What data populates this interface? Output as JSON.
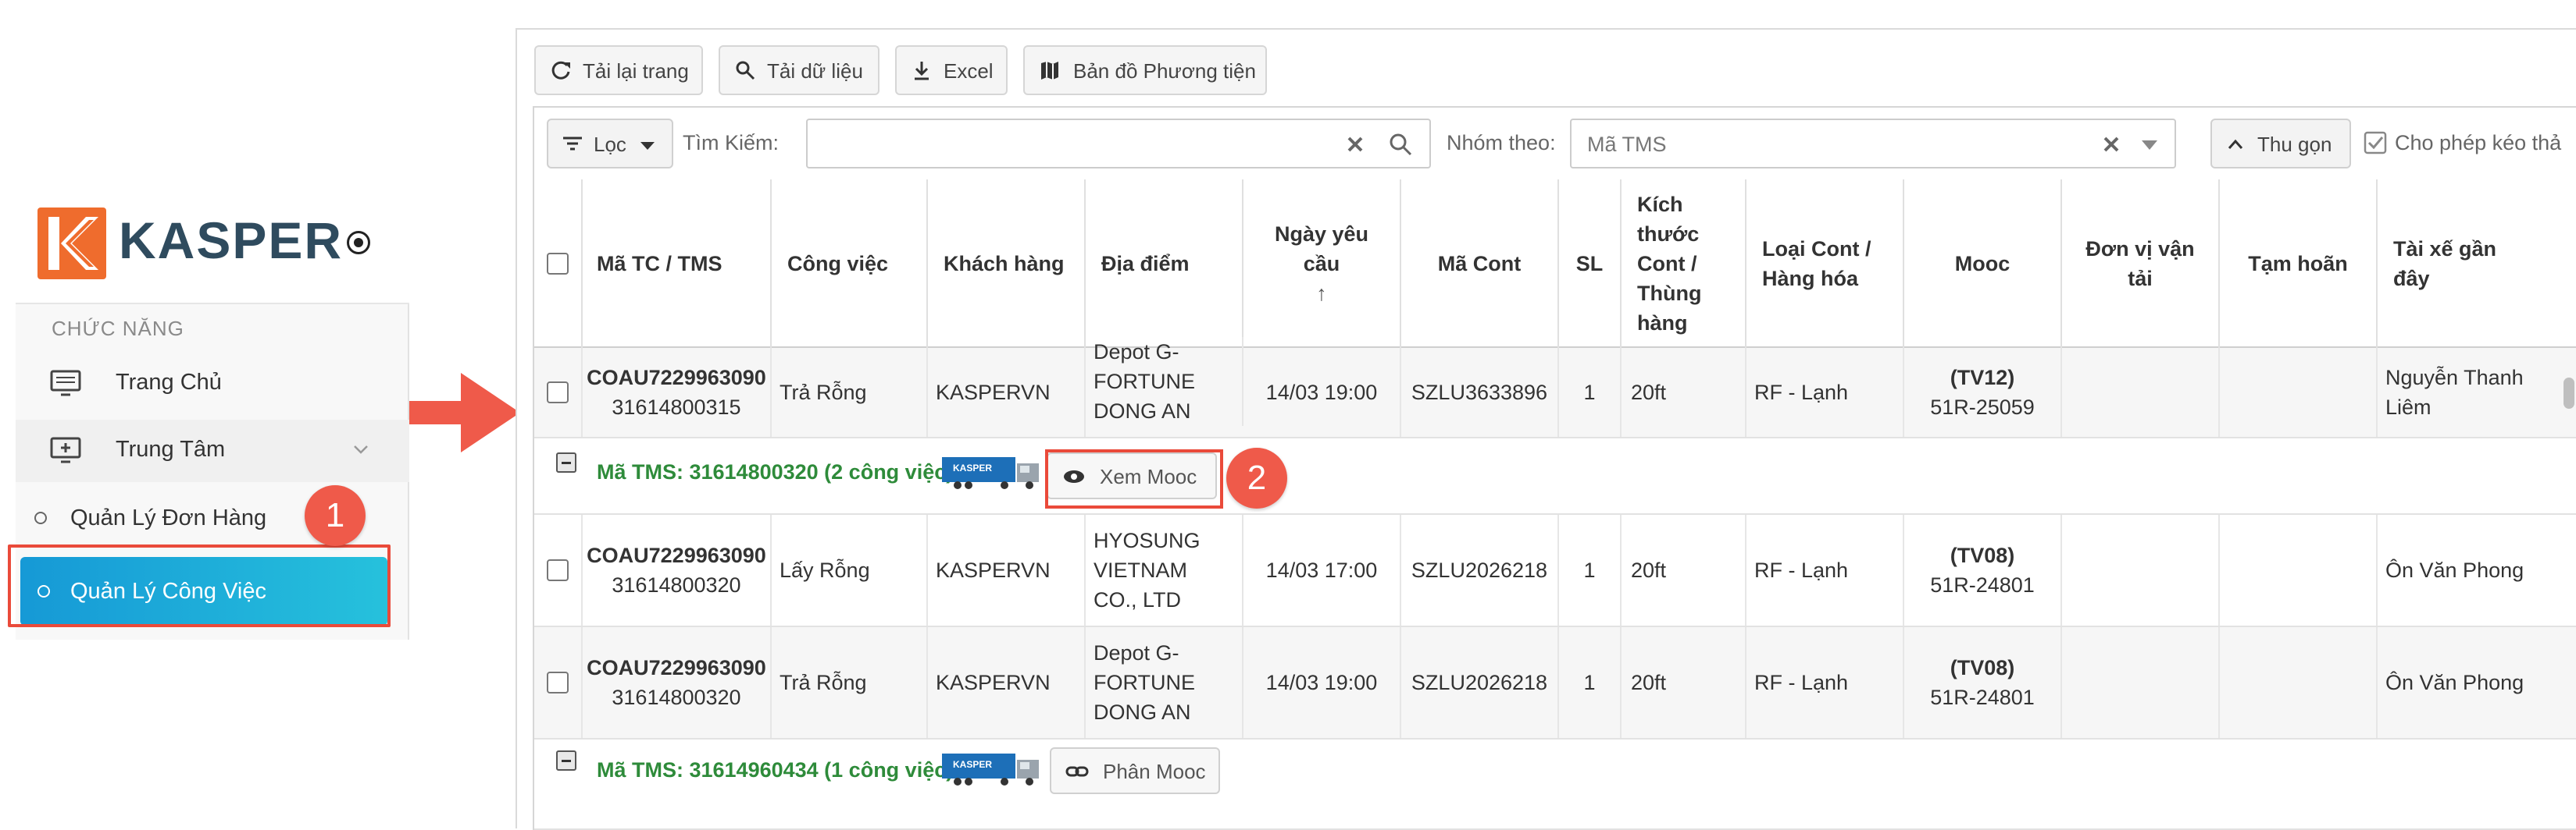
{
  "sidebar": {
    "brand": "KASPER",
    "section_label": "CHỨC NĂNG",
    "items": [
      {
        "label": "Trang Chủ"
      },
      {
        "label": "Trung Tâm"
      }
    ],
    "sub_items": [
      {
        "label": "Quản Lý Đơn Hàng"
      },
      {
        "label": "Quản Lý Công Việc"
      }
    ]
  },
  "markers": [
    "1",
    "2"
  ],
  "toolbar": {
    "reload": "Tải lại trang",
    "load_data": "Tải dữ liệu",
    "excel": "Excel",
    "vehicle_map": "Bản đồ Phương tiện"
  },
  "filter": {
    "filter_button": "Lọc",
    "search_label": "Tìm Kiếm:",
    "search_value": "",
    "group_label": "Nhóm theo:",
    "group_value": "Mã TMS",
    "collapse_button": "Thu gọn",
    "allow_drag_label": "Cho phép kéo thả"
  },
  "table": {
    "headers": {
      "code": "Mã TC / TMS",
      "job": "Công việc",
      "customer": "Khách hàng",
      "location": "Địa điểm",
      "request_date": "Ngày yêu cầu",
      "container": "Mã Cont",
      "qty": "SL",
      "size": "Kích thước Cont / Thùng hàng",
      "type": "Loại Cont / Hàng hóa",
      "mooc": "Mooc",
      "carrier": "Đơn vị vận tải",
      "suspend": "Tạm hoãn",
      "driver": "Tài xế gần đây"
    },
    "rows": [
      {
        "code": "COAU7229963090",
        "tms": "31614800315",
        "job": "Trả Rỗng",
        "customer": "KASPERVN",
        "location": "Depot G-FORTUNE DONG AN",
        "date": "14/03 19:00",
        "cont": "SZLU3633896",
        "qty": "1",
        "size": "20ft",
        "type": "RF - Lạnh",
        "mooc_code": "(TV12)",
        "mooc_plate": "51R-25059",
        "carrier": "",
        "suspend": "",
        "driver": "Nguyễn Thanh Liêm"
      },
      {
        "code": "COAU7229963090",
        "tms": "31614800320",
        "job": "Lấy Rỗng",
        "customer": "KASPERVN",
        "location": "HYOSUNG VIETNAM CO., LTD",
        "date": "14/03 17:00",
        "cont": "SZLU2026218",
        "qty": "1",
        "size": "20ft",
        "type": "RF - Lạnh",
        "mooc_code": "(TV08)",
        "mooc_plate": "51R-24801",
        "carrier": "",
        "suspend": "",
        "driver": "Ôn Văn Phong"
      },
      {
        "code": "COAU7229963090",
        "tms": "31614800320",
        "job": "Trả Rỗng",
        "customer": "KASPERVN",
        "location": "Depot G-FORTUNE DONG AN",
        "date": "14/03 19:00",
        "cont": "SZLU2026218",
        "qty": "1",
        "size": "20ft",
        "type": "RF - Lạnh",
        "mooc_code": "(TV08)",
        "mooc_plate": "51R-24801",
        "carrier": "",
        "suspend": "",
        "driver": "Ôn Văn Phong"
      }
    ],
    "groups": [
      {
        "title": "Mã TMS: 31614800320 (2 công việc)",
        "button": "Xem Mooc"
      },
      {
        "title": "Mã TMS: 31614960434 (1 công việc)",
        "button": "Phân Mooc"
      }
    ],
    "truck_brand": "KASPER"
  },
  "colors": {
    "accent": "#1699d6",
    "brand_orange": "#ef6c2d",
    "brand_dark": "#2f4b5e",
    "group_green": "#2e8b3a",
    "annotation_red": "#ea4a3a"
  }
}
